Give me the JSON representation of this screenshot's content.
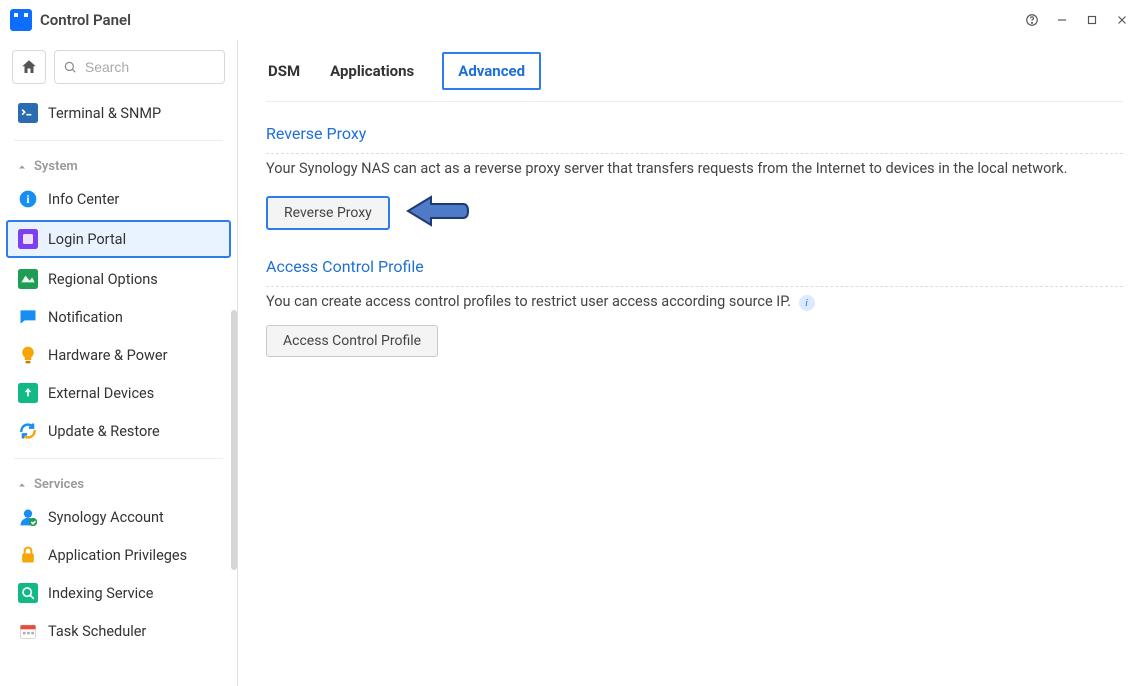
{
  "window": {
    "title": "Control Panel"
  },
  "sidebar": {
    "search_placeholder": "Search",
    "top_item": "Terminal & SNMP",
    "section_system": "System",
    "section_services": "Services",
    "items_system": [
      {
        "label": "Info Center"
      },
      {
        "label": "Login Portal"
      },
      {
        "label": "Regional Options"
      },
      {
        "label": "Notification"
      },
      {
        "label": "Hardware & Power"
      },
      {
        "label": "External Devices"
      },
      {
        "label": "Update & Restore"
      }
    ],
    "items_services": [
      {
        "label": "Synology Account"
      },
      {
        "label": "Application Privileges"
      },
      {
        "label": "Indexing Service"
      },
      {
        "label": "Task Scheduler"
      }
    ]
  },
  "main": {
    "tabs": {
      "dsm": "DSM",
      "applications": "Applications",
      "advanced": "Advanced"
    },
    "reverse_proxy": {
      "title": "Reverse Proxy",
      "desc": "Your Synology NAS can act as a reverse proxy server that transfers requests from the Internet to devices in the local network.",
      "button": "Reverse Proxy"
    },
    "acp": {
      "title": "Access Control Profile",
      "desc": "You can create access control profiles to restrict user access according source IP.",
      "button": "Access Control Profile"
    }
  }
}
